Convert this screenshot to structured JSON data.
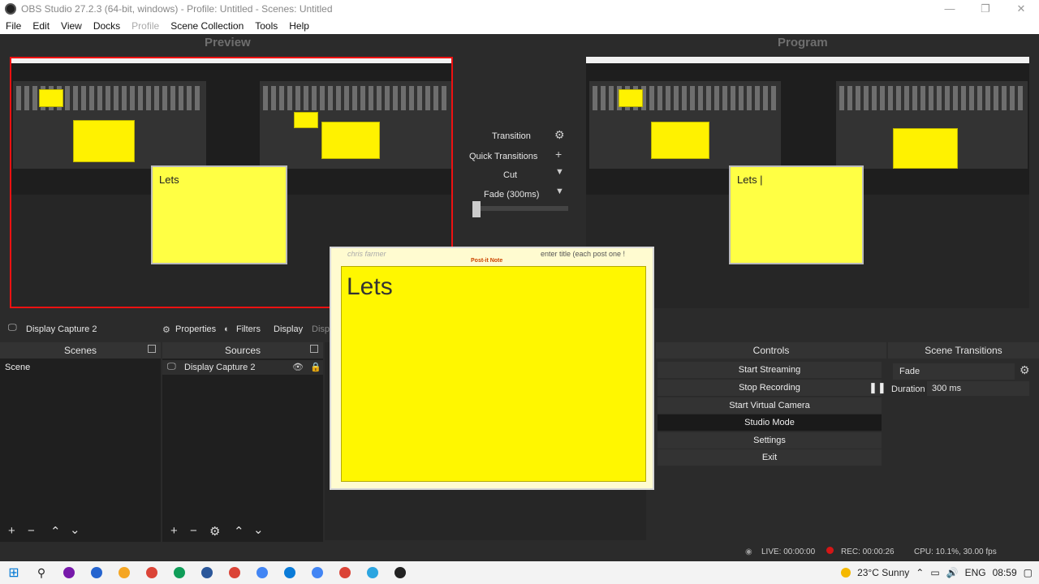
{
  "window": {
    "title": "OBS Studio 27.2.3 (64-bit, windows) - Profile: Untitled - Scenes: Untitled",
    "controls": [
      "—",
      "❐",
      "✕"
    ]
  },
  "menu": [
    "File",
    "Edit",
    "View",
    "Docks",
    "Profile",
    "Scene Collection",
    "Tools",
    "Help"
  ],
  "preview": {
    "label": "Preview",
    "sticky_text": "Lets"
  },
  "program": {
    "label": "Program",
    "sticky_text": "Lets |"
  },
  "transitions_center": {
    "transition_label": "Transition",
    "quick_transitions_label": "Quick Transitions",
    "cut_label": "Cut",
    "fade_label": "Fade (300ms)"
  },
  "source_toolbar": {
    "source_name": "Display Capture 2",
    "properties_label": "Properties",
    "filters_label": "Filters",
    "display_label": "Display",
    "display_truncated": "Displ"
  },
  "scenes": {
    "header": "Scenes",
    "items": [
      "Scene"
    ]
  },
  "sources": {
    "header": "Sources",
    "items": [
      {
        "name": "Display Capture 2",
        "icon": "monitor-icon",
        "visible": true,
        "locked": false
      }
    ]
  },
  "controls": {
    "header": "Controls",
    "buttons": [
      "Start Streaming",
      "Stop Recording",
      "Start Virtual Camera",
      "Studio Mode",
      "Settings",
      "Exit"
    ]
  },
  "scene_transitions": {
    "header": "Scene Transitions",
    "selected": "Fade",
    "duration_label": "Duration",
    "duration_value": "300 ms"
  },
  "overlay_note": {
    "text": "Lets",
    "header_left": "chris farmer",
    "header_center": "Post-it Note",
    "header_right": "enter title (each post one !"
  },
  "status": {
    "live": "LIVE: 00:00:00",
    "rec": "REC: 00:00:26",
    "cpu": "CPU: 10.1%, 30.00 fps"
  },
  "taskbar": {
    "weather": "23°C  Sunny",
    "lang": "ENG",
    "time": "08:59"
  },
  "colors": {
    "accent_red": "#e11111",
    "sticky_yellow": "#fff200",
    "rec_red": "#d41616"
  }
}
